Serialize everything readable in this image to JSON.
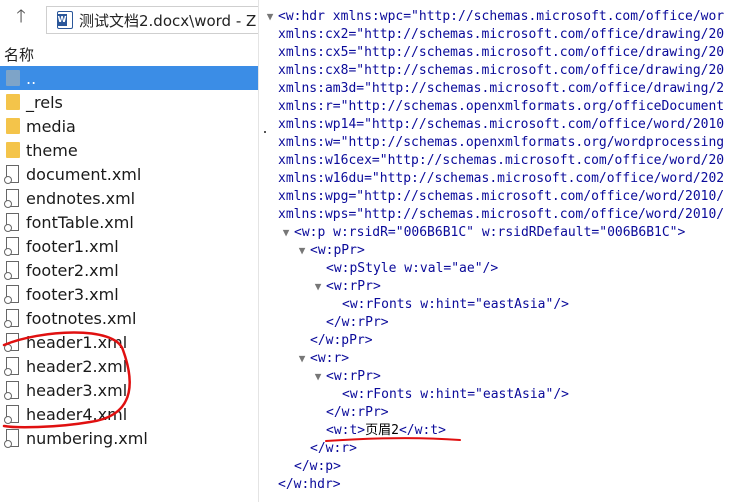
{
  "toolbar": {
    "up_icon": "arrow-up-icon",
    "address_text": "测试文档2.docx\\word - Z"
  },
  "list_header": "名称",
  "files": [
    {
      "name": "..",
      "type": "folder-up",
      "selected": true
    },
    {
      "name": "_rels",
      "type": "folder"
    },
    {
      "name": "media",
      "type": "folder"
    },
    {
      "name": "theme",
      "type": "folder"
    },
    {
      "name": "document.xml",
      "type": "file"
    },
    {
      "name": "endnotes.xml",
      "type": "file"
    },
    {
      "name": "fontTable.xml",
      "type": "file"
    },
    {
      "name": "footer1.xml",
      "type": "file"
    },
    {
      "name": "footer2.xml",
      "type": "file"
    },
    {
      "name": "footer3.xml",
      "type": "file"
    },
    {
      "name": "footnotes.xml",
      "type": "file"
    },
    {
      "name": "header1.xml",
      "type": "file"
    },
    {
      "name": "header2.xml",
      "type": "file"
    },
    {
      "name": "header3.xml",
      "type": "file"
    },
    {
      "name": "header4.xml",
      "type": "file"
    },
    {
      "name": "numbering.xml",
      "type": "file"
    }
  ],
  "xml_lines": [
    {
      "indent": 0,
      "toggle": "▼",
      "text": "<w:hdr xmlns:wpc=\"http://schemas.microsoft.com/office/wor"
    },
    {
      "indent": 0,
      "toggle": "",
      "text": "xmlns:cx2=\"http://schemas.microsoft.com/office/drawing/20"
    },
    {
      "indent": 0,
      "toggle": "",
      "text": "xmlns:cx5=\"http://schemas.microsoft.com/office/drawing/20"
    },
    {
      "indent": 0,
      "toggle": "",
      "text": "xmlns:cx8=\"http://schemas.microsoft.com/office/drawing/20"
    },
    {
      "indent": 0,
      "toggle": "",
      "text": "xmlns:am3d=\"http://schemas.microsoft.com/office/drawing/2"
    },
    {
      "indent": 0,
      "toggle": "",
      "text": "xmlns:r=\"http://schemas.openxmlformats.org/officeDocument"
    },
    {
      "indent": 0,
      "toggle": "",
      "text": "xmlns:wp14=\"http://schemas.microsoft.com/office/word/2010"
    },
    {
      "indent": 0,
      "toggle": "",
      "text": "xmlns:w=\"http://schemas.openxmlformats.org/wordprocessing"
    },
    {
      "indent": 0,
      "toggle": "",
      "text": "xmlns:w16cex=\"http://schemas.microsoft.com/office/word/20"
    },
    {
      "indent": 0,
      "toggle": "",
      "text": "xmlns:w16du=\"http://schemas.microsoft.com/office/word/202"
    },
    {
      "indent": 0,
      "toggle": "",
      "text": "xmlns:wpg=\"http://schemas.microsoft.com/office/word/2010/"
    },
    {
      "indent": 0,
      "toggle": "",
      "text": "xmlns:wps=\"http://schemas.microsoft.com/office/word/2010/"
    },
    {
      "indent": 1,
      "toggle": "▼",
      "text": "<w:p w:rsidR=\"006B6B1C\" w:rsidRDefault=\"006B6B1C\">"
    },
    {
      "indent": 2,
      "toggle": "▼",
      "text": "<w:pPr>"
    },
    {
      "indent": 3,
      "toggle": "",
      "text": "<w:pStyle w:val=\"ae\"/>"
    },
    {
      "indent": 3,
      "toggle": "▼",
      "text": "<w:rPr>"
    },
    {
      "indent": 4,
      "toggle": "",
      "text": "<w:rFonts w:hint=\"eastAsia\"/>"
    },
    {
      "indent": 3,
      "toggle": "",
      "text": "</w:rPr>"
    },
    {
      "indent": 2,
      "toggle": "",
      "text": "</w:pPr>"
    },
    {
      "indent": 2,
      "toggle": "▼",
      "text": "<w:r>"
    },
    {
      "indent": 3,
      "toggle": "▼",
      "text": "<w:rPr>"
    },
    {
      "indent": 4,
      "toggle": "",
      "text": "<w:rFonts w:hint=\"eastAsia\"/>"
    },
    {
      "indent": 3,
      "toggle": "",
      "text": "</w:rPr>"
    },
    {
      "indent": 3,
      "toggle": "",
      "text": "<w:t>",
      "content": "页眉2",
      "close": "</w:t>"
    },
    {
      "indent": 2,
      "toggle": "",
      "text": "</w:r>"
    },
    {
      "indent": 1,
      "toggle": "",
      "text": "</w:p>"
    },
    {
      "indent": 0,
      "toggle": "",
      "text": "</w:hdr>"
    }
  ],
  "annotation_color": "#e01010"
}
